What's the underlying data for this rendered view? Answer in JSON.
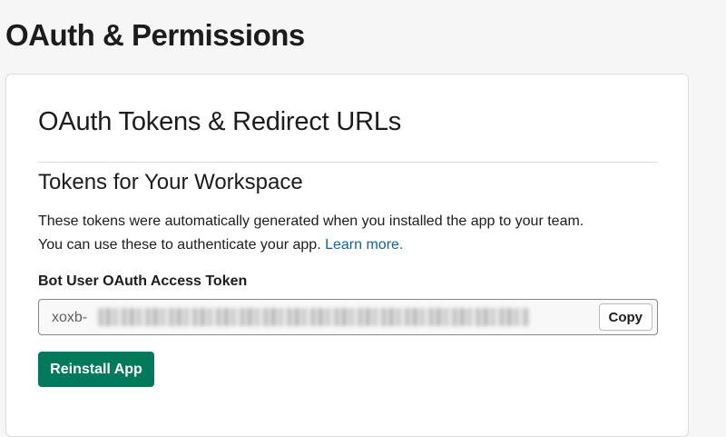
{
  "page": {
    "title": "OAuth & Permissions"
  },
  "card": {
    "section_title": "OAuth Tokens & Redirect URLs",
    "subsection_title": "Tokens for Your Workspace",
    "description_line1": "These tokens were automatically generated when you installed the app to your team.",
    "description_line2": "You can use these to authenticate your app.",
    "learn_more_link": "Learn more.",
    "token_label": "Bot User OAuth Access Token",
    "token_prefix": "xoxb-",
    "copy_label": "Copy",
    "reinstall_label": "Reinstall App"
  },
  "colors": {
    "background": "#f6f6f6",
    "card": "#ffffff",
    "link": "#1264a3",
    "primary_button": "#007a5a"
  }
}
